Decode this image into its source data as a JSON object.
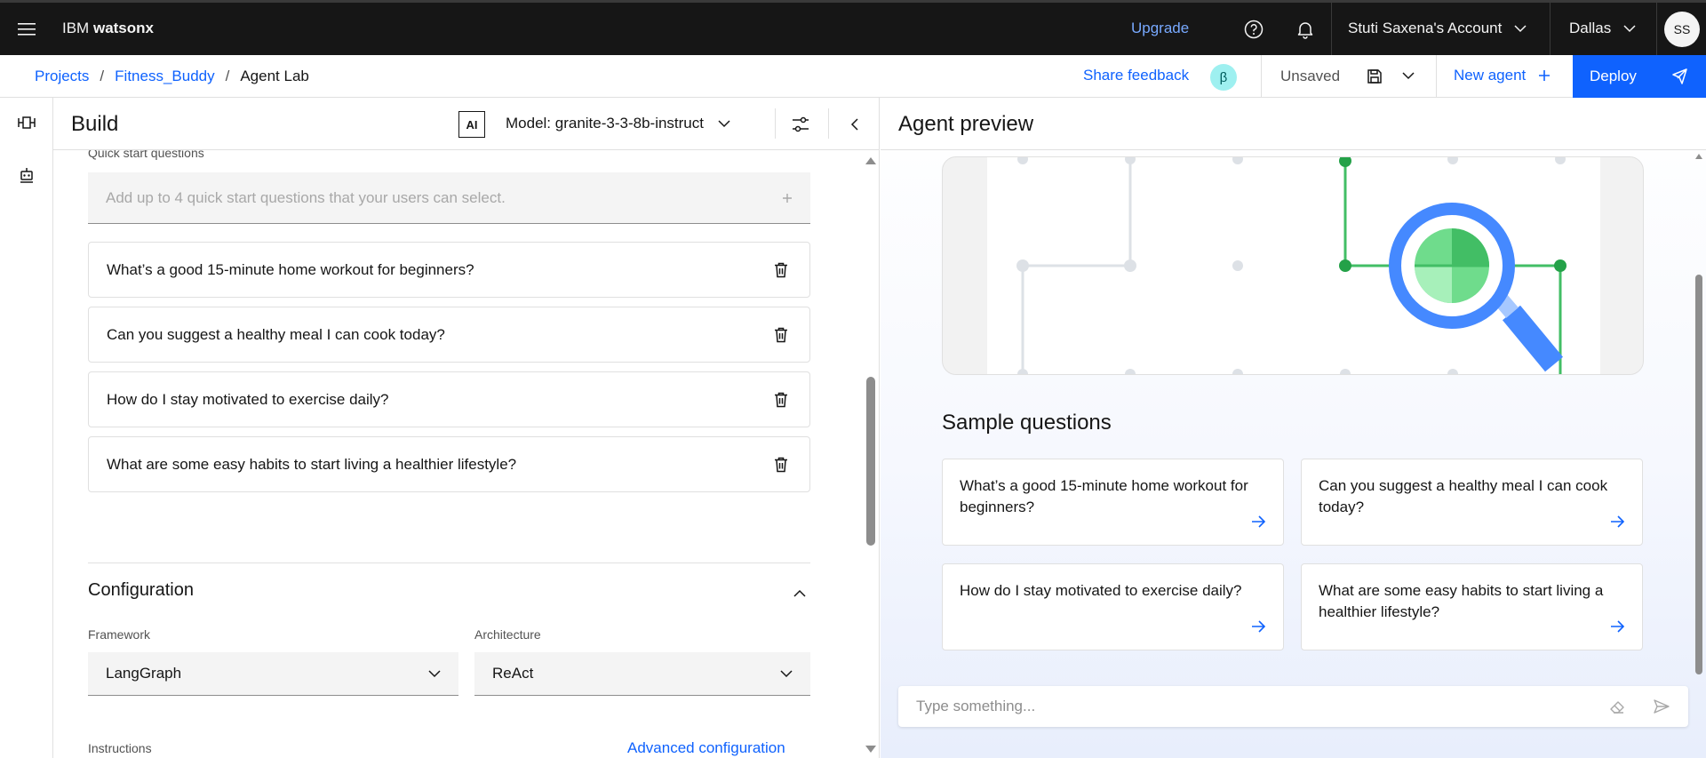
{
  "header": {
    "brand_prefix": "IBM",
    "brand_product": "watsonx",
    "upgrade": "Upgrade",
    "account": "Stuti Saxena's Account",
    "region": "Dallas",
    "avatar_initials": "SS"
  },
  "subheader": {
    "breadcrumbs": [
      "Projects",
      "Fitness_Buddy",
      "Agent Lab"
    ],
    "share_feedback": "Share feedback",
    "beta_badge": "β",
    "save_status": "Unsaved",
    "new_agent": "New agent",
    "deploy": "Deploy"
  },
  "build": {
    "title": "Build",
    "ai_badge": "AI",
    "model_label": "Model: granite-3-3-8b-instruct",
    "quick_start_label": "Quick start questions",
    "quick_start_placeholder": "Add up to 4 quick start questions that your users can select.",
    "questions": [
      "What’s a good 15-minute home workout for beginners?",
      "Can you suggest a healthy meal I can cook today?",
      "How do I stay motivated to exercise daily?",
      "What are some easy habits to start living a healthier lifestyle?"
    ],
    "configuration_title": "Configuration",
    "framework_label": "Framework",
    "framework_value": "LangGraph",
    "architecture_label": "Architecture",
    "architecture_value": "ReAct",
    "instructions_label": "Instructions",
    "advanced_configuration": "Advanced configuration"
  },
  "preview": {
    "title": "Agent preview",
    "sample_questions_title": "Sample questions",
    "sample_questions": [
      "What’s a good 15-minute home workout for beginners?",
      "Can you suggest a healthy meal I can cook today?",
      "How do I stay motivated to exercise daily?",
      "What are some easy habits to start living a healthier lifestyle?"
    ],
    "chat_placeholder": "Type something..."
  },
  "colors": {
    "accent_blue": "#0f62fe",
    "header_bg": "#161616",
    "illustration_green": "#42be65",
    "illustration_blue": "#4589ff"
  },
  "icons": [
    "menu-icon",
    "help-icon",
    "notification-icon",
    "chevron-down-icon",
    "save-icon",
    "add-icon",
    "send-icon",
    "trash-icon",
    "settings-adjust-icon",
    "chevron-left-icon",
    "chevron-up-icon",
    "arrow-right-icon",
    "eraser-icon",
    "agent-icon",
    "flow-icon"
  ]
}
